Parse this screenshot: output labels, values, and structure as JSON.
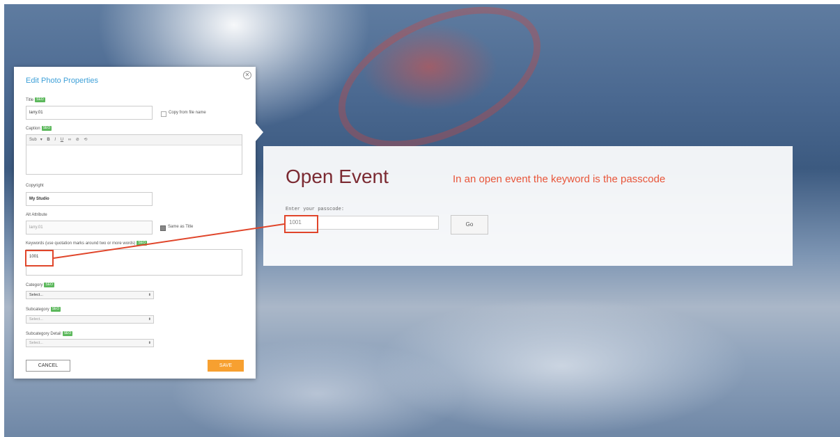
{
  "panel": {
    "title": "Edit Photo Properties",
    "badge": "SEO",
    "title_label": "Title",
    "title_value": "larry.01",
    "copy_from_filename": "Copy from file name",
    "caption_label": "Caption",
    "editor_toolbar": {
      "font": "Sub",
      "bold": "B",
      "italic": "I",
      "underline": "U"
    },
    "copyright_label": "Copyright",
    "copyright_value": "My Studio",
    "alt_label": "Alt Attribute",
    "alt_value": "larry.01",
    "same_as_title": "Same as Title",
    "keywords_label": "Keywords (use quotation marks around two or more words)",
    "keywords_value": "1001",
    "category_label": "Category",
    "category_value": "Select...",
    "subcategory_label": "Subcategory",
    "subcategory_value": "Select...",
    "subcategory_detail_label": "Subcategory Detail",
    "subcategory_detail_value": "Select...",
    "cancel": "CANCEL",
    "save": "SAVE"
  },
  "event": {
    "title": "Open Event",
    "note": "In an open event the keyword is the passcode",
    "passcode_label": "Enter your passcode:",
    "passcode_value": "1001",
    "go": "Go"
  },
  "colors": {
    "accent_blue": "#3ea0d8",
    "save_orange": "#f7a030",
    "event_title": "#7b2a32",
    "annotation_red": "#e0452a",
    "seo_badge_green": "#5cb85c"
  }
}
